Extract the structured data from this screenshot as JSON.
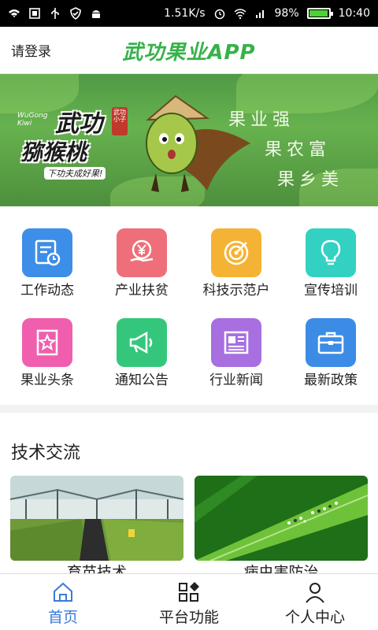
{
  "status_bar": {
    "speed": "1.51K/s",
    "battery": "98%",
    "battery_level": 0.98,
    "time": "10:40"
  },
  "header": {
    "login": "请登录",
    "title": "武功果业APP"
  },
  "banner": {
    "brand_line1": "武功",
    "brand_line2": "猕猴桃",
    "brand_english": "WuGong Kiwi",
    "brand_tag": "武功小子",
    "slogan": "下功夫成好果!",
    "lines": [
      "果业强",
      "果农富",
      "果乡美"
    ]
  },
  "features": [
    {
      "label": "工作动态",
      "icon": "calendar-icon",
      "color": "#3d8ee8"
    },
    {
      "label": "产业扶贫",
      "icon": "yuan-hand-icon",
      "color": "#ee6f7a"
    },
    {
      "label": "科技示范户",
      "icon": "target-icon",
      "color": "#f5b335"
    },
    {
      "label": "宣传培训",
      "icon": "lightbulb-icon",
      "color": "#33d1c2"
    },
    {
      "label": "果业头条",
      "icon": "star-badge-icon",
      "color": "#ef5fae"
    },
    {
      "label": "通知公告",
      "icon": "megaphone-icon",
      "color": "#34c77b"
    },
    {
      "label": "行业新闻",
      "icon": "newspaper-icon",
      "color": "#a86fe0"
    },
    {
      "label": "最新政策",
      "icon": "briefcase-icon",
      "color": "#3c8ce6"
    }
  ],
  "section": {
    "title": "技术交流",
    "cards": [
      {
        "label": "育苗技术",
        "image": "greenhouse-seedlings-image"
      },
      {
        "label": "病虫害防治",
        "image": "leaf-pests-image"
      }
    ]
  },
  "bottom_nav": [
    {
      "label": "首页",
      "icon": "home-icon",
      "active": true
    },
    {
      "label": "平台功能",
      "icon": "grid-icon",
      "active": false
    },
    {
      "label": "个人中心",
      "icon": "person-icon",
      "active": false
    }
  ],
  "colors": {
    "brand_green": "#36b24a",
    "active_blue": "#3a7bd5"
  }
}
